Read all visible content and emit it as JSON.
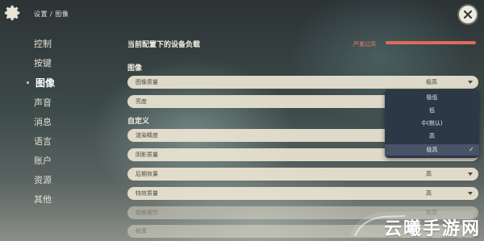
{
  "header": {
    "breadcrumb": "设置 / 图像"
  },
  "sidebar": {
    "items": [
      {
        "label": "控制"
      },
      {
        "label": "按键"
      },
      {
        "label": "图像"
      },
      {
        "label": "声音"
      },
      {
        "label": "消息"
      },
      {
        "label": "语言"
      },
      {
        "label": "账户"
      },
      {
        "label": "资源"
      },
      {
        "label": "其他"
      }
    ],
    "active_index": 2
  },
  "main": {
    "load_title": "当前配置下的设备负载",
    "load_status": "严重过高",
    "section_image": "图像",
    "section_custom": "自定义",
    "rows": [
      {
        "label": "图像质量",
        "value": "极高"
      },
      {
        "label": "亮度",
        "value": ""
      },
      {
        "label": "渲染精度",
        "value": ""
      },
      {
        "label": "阴影质量",
        "value": ""
      },
      {
        "label": "后期效果",
        "value": "高"
      },
      {
        "label": "特效质量",
        "value": "高"
      },
      {
        "label": "场景细节",
        "value": "极高"
      },
      {
        "label": "帧率",
        "value": ""
      }
    ]
  },
  "dropdown": {
    "options": [
      "极低",
      "低",
      "中(默认)",
      "高",
      "极高"
    ],
    "selected": "极高"
  },
  "watermark": {
    "text": "云曦手游网"
  },
  "colors": {
    "load_bar": "#e06a5a",
    "row_bg": "#ece5d3",
    "dropdown_bg": "#2d3847"
  }
}
